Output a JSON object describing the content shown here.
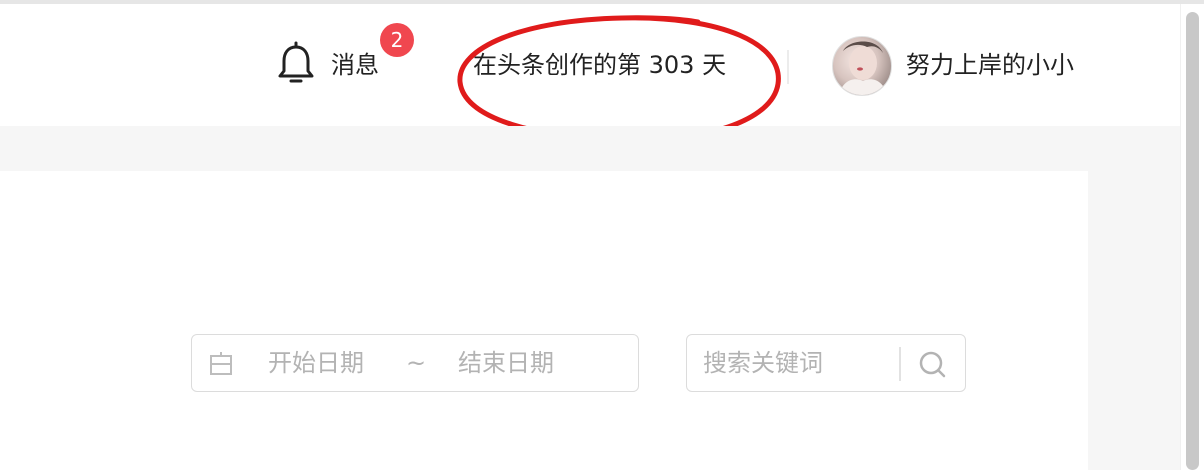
{
  "header": {
    "notifications": {
      "icon": "bell-icon",
      "label": "消息",
      "badge_count": "2",
      "badge_color": "#f0474f"
    },
    "creation_days": "在头条创作的第 303 天",
    "user": {
      "avatar_icon": "user-avatar",
      "name": "努力上岸的小小"
    }
  },
  "annotation": {
    "shape": "ellipse",
    "color": "#e01b1b"
  },
  "filters": {
    "date_range": {
      "icon": "calendar-icon",
      "start_placeholder": "开始日期",
      "separator": "~",
      "end_placeholder": "结束日期"
    },
    "search": {
      "placeholder": "搜索关键词",
      "icon": "search-icon"
    }
  }
}
